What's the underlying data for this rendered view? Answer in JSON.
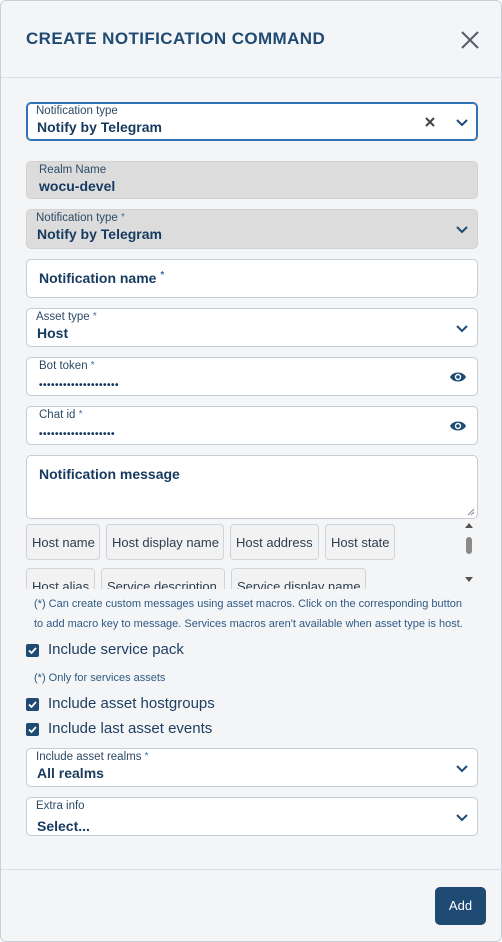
{
  "modal": {
    "title": "CREATE NOTIFICATION COMMAND",
    "close_icon": "close-icon"
  },
  "notification_type_filter": {
    "label": "Notification type",
    "value": "Notify by Telegram"
  },
  "realm_name": {
    "label": "Realm Name",
    "value": "wocu-devel"
  },
  "notification_type": {
    "label": "Notification type",
    "required_mark": "*",
    "value": "Notify by Telegram"
  },
  "notification_name": {
    "label": "Notification name",
    "required_mark": "*"
  },
  "asset_type": {
    "label": "Asset type",
    "required_mark": "*",
    "value": "Host"
  },
  "bot_token": {
    "label": "Bot token",
    "required_mark": "*",
    "masked_value": "••••••••••••••••••••",
    "icon": "eye-icon"
  },
  "chat_id": {
    "label": "Chat id",
    "required_mark": "*",
    "masked_value": "•••••••••••••••••••",
    "icon": "eye-icon"
  },
  "notification_message": {
    "label": "Notification message"
  },
  "macros": [
    "Host name",
    "Host display name",
    "Host address",
    "Host state",
    "Host alias",
    "Service description",
    "Service display name"
  ],
  "macro_help": "(*) Can create custom messages using asset macros. Click on the corresponding button to add macro key to message. Services macros aren't available when asset type is host.",
  "checkboxes": {
    "include_service_pack": "Include service pack",
    "service_pack_help": "(*) Only for services assets",
    "include_asset_hostgroups": "Include asset hostgroups",
    "include_last_asset_events": "Include last asset events"
  },
  "include_asset_realms": {
    "label": "Include asset realms",
    "required_mark": "*",
    "value": "All realms"
  },
  "extra_info": {
    "label": "Extra info",
    "placeholder": "Select..."
  },
  "footer": {
    "add_label": "Add"
  },
  "colors": {
    "primary": "#1e4a74",
    "accent_border": "#2f73b5",
    "disabled_bg": "#dcdcdc",
    "panel_bg": "#f4f5f6"
  }
}
